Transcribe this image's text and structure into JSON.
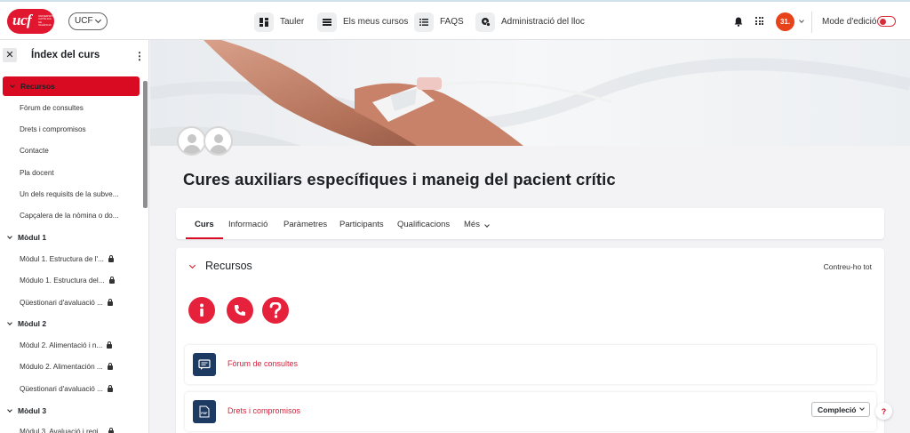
{
  "logo": {
    "text": "ucf",
    "tagline": "UNIVERSITAT CATÒLICA DE VALÈNCIA"
  },
  "header": {
    "category_button": "UCF",
    "nav": [
      {
        "label": "Tauler",
        "icon": "dashboard-icon"
      },
      {
        "label": "Els meus cursos",
        "icon": "courses-icon"
      },
      {
        "label": "FAQS",
        "icon": "list-icon"
      },
      {
        "label": "Administració del lloc",
        "icon": "admin-gear-icon"
      }
    ],
    "avatar_initials": "31.",
    "edit_mode_label": "Mode d'edició",
    "edit_mode_on": false
  },
  "drawer": {
    "title": "Índex del curs",
    "items": [
      {
        "label": "Recursos",
        "type": "section",
        "active": true
      },
      {
        "label": "Fòrum de consultes",
        "type": "item",
        "locked": false
      },
      {
        "label": "Drets i compromisos",
        "type": "item",
        "locked": false
      },
      {
        "label": "Contacte",
        "type": "item",
        "locked": false
      },
      {
        "label": "Pla docent",
        "type": "item",
        "locked": false
      },
      {
        "label": "Un dels requisits de la subve...",
        "type": "item",
        "locked": false
      },
      {
        "label": "Capçalera de la nòmina o do...",
        "type": "item",
        "locked": false
      },
      {
        "label": "Mòdul 1",
        "type": "section",
        "active": false
      },
      {
        "label": "Mòdul 1. Estructura de l'...",
        "type": "item",
        "locked": true
      },
      {
        "label": "Módulo 1. Estructura del...",
        "type": "item",
        "locked": true
      },
      {
        "label": "Qüestionari d'avaluació ...",
        "type": "item",
        "locked": true
      },
      {
        "label": "Mòdul 2",
        "type": "section",
        "active": false
      },
      {
        "label": "Mòdul 2. Alimentació i n...",
        "type": "item",
        "locked": true
      },
      {
        "label": "Módulo 2. Alimentación ...",
        "type": "item",
        "locked": true
      },
      {
        "label": "Qüestionari d'avaluació ...",
        "type": "item",
        "locked": true
      },
      {
        "label": "Mòdul 3",
        "type": "section",
        "active": false
      },
      {
        "label": "Mòdul 3. Avaluació i regi...",
        "type": "item",
        "locked": true
      }
    ]
  },
  "course": {
    "title": "Cures auxiliars específiques i maneig del pacient crític",
    "tabs": [
      "Curs",
      "Informació",
      "Paràmetres",
      "Participants",
      "Qualificacions",
      "Més"
    ],
    "active_tab": "Curs"
  },
  "section": {
    "title": "Recursos",
    "collapse_all": "Contreu-ho tot",
    "quick_icons": [
      "info-icon",
      "phone-icon",
      "question-icon"
    ],
    "activities": [
      {
        "name": "Fòrum de consultes",
        "icon": "forum-icon"
      },
      {
        "name": "Drets i compromisos",
        "icon": "pdf-icon",
        "completion_label": "Compleció"
      }
    ]
  },
  "help_button": "?",
  "colors": {
    "brand_red": "#d90b22",
    "activity_icon_bg": "#1d3a63",
    "link_red": "#d6213b"
  }
}
